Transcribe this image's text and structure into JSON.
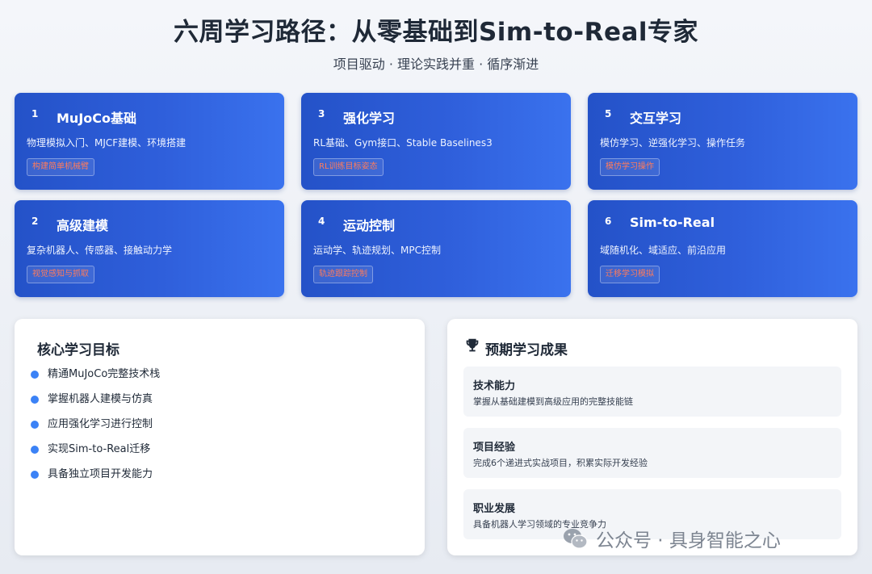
{
  "header": {
    "title": "六周学习路径：从零基础到Sim-to-Real专家",
    "subtitle": "项目驱动 · 理论实践并重 · 循序渐进"
  },
  "weeks": [
    {
      "num": "1",
      "title": "MuJoCo基础",
      "desc": "物理模拟入门、MJCF建模、环境搭建",
      "tag": "构建简单机械臂"
    },
    {
      "num": "2",
      "title": "高级建模",
      "desc": "复杂机器人、传感器、接触动力学",
      "tag": "视觉感知与抓取"
    },
    {
      "num": "3",
      "title": "强化学习",
      "desc": "RL基础、Gym接口、Stable Baselines3",
      "tag": "RL训练目标姿态"
    },
    {
      "num": "4",
      "title": "运动控制",
      "desc": "运动学、轨迹规划、MPC控制",
      "tag": "轨迹跟踪控制"
    },
    {
      "num": "5",
      "title": "交互学习",
      "desc": "模仿学习、逆强化学习、操作任务",
      "tag": "模仿学习操作"
    },
    {
      "num": "6",
      "title": "Sim-to-Real",
      "desc": "域随机化、域适应、前沿应用",
      "tag": "迁移学习模拟"
    }
  ],
  "goals_panel": {
    "title": "核心学习目标",
    "items": [
      "精通MuJoCo完整技术栈",
      "掌握机器人建模与仿真",
      "应用强化学习进行控制",
      "实现Sim-to-Real迁移",
      "具备独立项目开发能力"
    ]
  },
  "outcomes_panel": {
    "icon": "trophy-icon",
    "title": "预期学习成果",
    "items": [
      {
        "title": "技术能力",
        "desc": "掌握从基础建模到高级应用的完整技能链"
      },
      {
        "title": "项目经验",
        "desc": "完成6个递进式实战项目，积累实际开发经验"
      },
      {
        "title": "职业发展",
        "desc": "具备机器人学习领域的专业竞争力"
      }
    ]
  },
  "watermark": {
    "icon": "wechat-icon",
    "text": "公众号 · 具身智能之心"
  },
  "colors": {
    "card_start": "#2452c8",
    "card_end": "#3a72ee",
    "tag_text": "#ff7b5c",
    "bullet": "#3b82f6"
  }
}
